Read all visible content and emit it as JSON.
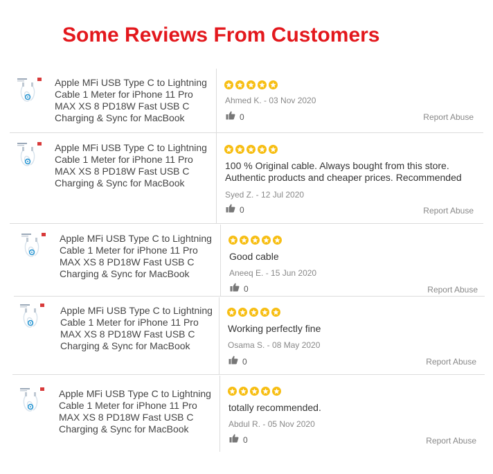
{
  "page": {
    "title": "Some Reviews From Customers"
  },
  "colors": {
    "title": "#e3181d",
    "star": "#f7be13",
    "divider": "#dcdcdc",
    "meta": "#888888"
  },
  "report_label": "Report Abuse",
  "reviews": [
    {
      "product": "Apple MFi USB Type C to Lightning Cable 1 Meter for iPhone 11 Pro MAX XS 8 PD18W Fast USB C Charging & Sync for MacBook",
      "rating": 5,
      "text": "",
      "author_date": "Ahmed K. - 03 Nov 2020",
      "likes": "0"
    },
    {
      "product": "Apple MFi USB Type C to Lightning Cable 1 Meter for iPhone 11 Pro MAX XS 8 PD18W Fast USB C Charging & Sync for MacBook",
      "rating": 5,
      "text_line1": "100 % Original cable. Always bought from this store.",
      "text_line2": "Authentic products and cheaper prices. Recommended",
      "author_date": "Syed Z. - 12 Jul 2020",
      "likes": "0"
    },
    {
      "product": "Apple MFi USB Type C to Lightning Cable 1 Meter for iPhone 11 Pro MAX XS 8 PD18W Fast USB C Charging & Sync for MacBook",
      "rating": 5,
      "text": "Good cable",
      "author_date": "Aneeq E. - 15 Jun 2020",
      "likes": "0"
    },
    {
      "product": "Apple MFi USB Type C to Lightning Cable 1 Meter for iPhone 11 Pro MAX XS 8 PD18W Fast USB C Charging & Sync for MacBook",
      "rating": 5,
      "text": "Working perfectly fine",
      "author_date": "Osama S. - 08 May 2020",
      "likes": "0"
    },
    {
      "product": "Apple MFi USB Type C to Lightning Cable 1 Meter for iPhone 11 Pro MAX XS 8 PD18W Fast USB C Charging & Sync for MacBook",
      "rating": 5,
      "text": "totally recommended.",
      "author_date": "Abdul R. - 05 Nov 2020",
      "likes": "0"
    }
  ]
}
